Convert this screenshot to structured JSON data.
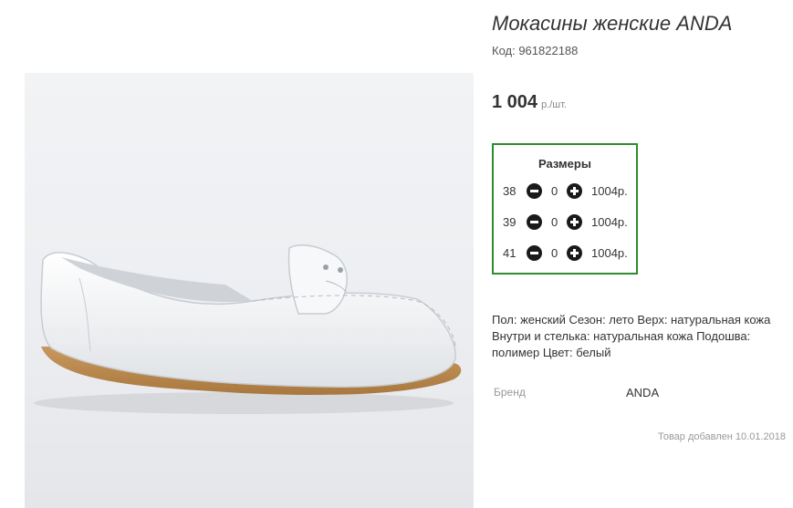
{
  "product": {
    "title": "Мокасины женские ANDA",
    "code": "Код: 961822188",
    "price": "1 004",
    "price_unit": "р./шт."
  },
  "sizes": {
    "header": "Размеры",
    "rows": [
      {
        "size": "38",
        "qty": "0",
        "price": "1004р."
      },
      {
        "size": "39",
        "qty": "0",
        "price": "1004р."
      },
      {
        "size": "41",
        "qty": "0",
        "price": "1004р."
      }
    ]
  },
  "description": "Пол: женский Сезон: лето Верх: натуральная кожа Внутри и стелька: натуральная кожа Подошва: полимер Цвет: белый",
  "brand": {
    "label": "Бренд",
    "value": "ANDA"
  },
  "added": "Товар добавлен 10.01.2018",
  "colors": {
    "accent_border": "#2e8b2e",
    "button": "#1a1a1a"
  },
  "icons": {
    "minus": "minus-circle-icon",
    "plus": "plus-circle-icon"
  }
}
